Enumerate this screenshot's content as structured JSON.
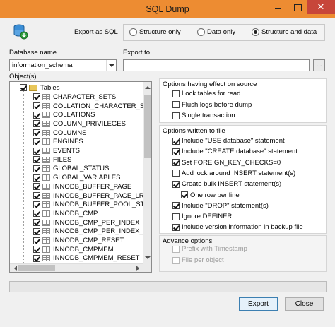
{
  "window": {
    "title": "SQL Dump",
    "close_glyph": "✕"
  },
  "export_as": {
    "label": "Export as SQL",
    "options": [
      {
        "label": "Structure only",
        "selected": false
      },
      {
        "label": "Data only",
        "selected": false
      },
      {
        "label": "Structure and data",
        "selected": true
      }
    ]
  },
  "database": {
    "label": "Database name",
    "value": "information_schema"
  },
  "export_to": {
    "label": "Export to",
    "value": "",
    "browse_label": "..."
  },
  "objects": {
    "label": "Object(s)",
    "root": {
      "label": "Tables",
      "checked": true,
      "icon": "folder-icon"
    },
    "items": [
      "CHARACTER_SETS",
      "COLLATION_CHARACTER_SET_AP",
      "COLLATIONS",
      "COLUMN_PRIVILEGES",
      "COLUMNS",
      "ENGINES",
      "EVENTS",
      "FILES",
      "GLOBAL_STATUS",
      "GLOBAL_VARIABLES",
      "INNODB_BUFFER_PAGE",
      "INNODB_BUFFER_PAGE_LRU",
      "INNODB_BUFFER_POOL_STATS",
      "INNODB_CMP",
      "INNODB_CMP_PER_INDEX",
      "INNODB_CMP_PER_INDEX_RESET",
      "INNODB_CMP_RESET",
      "INNODB_CMPMEM",
      "INNODB_CMPMEM_RESET"
    ]
  },
  "source_options": {
    "title": "Options having effect on source",
    "items": [
      {
        "label": "Lock tables for read",
        "checked": false
      },
      {
        "label": "Flush logs before dump",
        "checked": false
      },
      {
        "label": "Single transaction",
        "checked": false
      }
    ]
  },
  "file_options": {
    "title": "Options written to file",
    "items": [
      {
        "label": "Include \"USE database\" statement",
        "checked": true
      },
      {
        "label": "Include \"CREATE database\" statement",
        "checked": true
      },
      {
        "label": "Set FOREIGN_KEY_CHECKS=0",
        "checked": true
      },
      {
        "label": "Add lock around INSERT statement(s)",
        "checked": false
      },
      {
        "label": "Create bulk INSERT statement(s)",
        "checked": true
      },
      {
        "label": "One row per line",
        "checked": true
      },
      {
        "label": "Include \"DROP\" statement(s)",
        "checked": true
      },
      {
        "label": "Ignore DEFINER",
        "checked": false
      },
      {
        "label": "Include version information in backup file",
        "checked": true
      }
    ]
  },
  "advance_options": {
    "title": "Advance options",
    "items": [
      {
        "label": "Prefix with Timestamp",
        "checked": false
      },
      {
        "label": "File per object",
        "checked": false
      }
    ]
  },
  "buttons": {
    "export": "Export",
    "close": "Close"
  },
  "progress": {
    "value": 0
  },
  "colors": {
    "titlebar": "#ed8c32",
    "close_button": "#c7463a",
    "primary_border": "#3c7fb1"
  }
}
